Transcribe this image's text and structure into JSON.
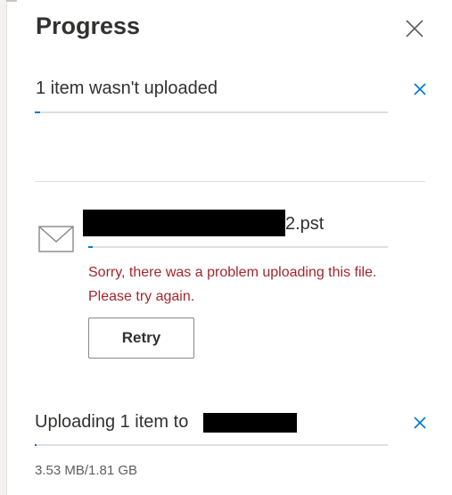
{
  "panel": {
    "title": "Progress"
  },
  "failed_item": {
    "summary": "1 item wasn't uploaded",
    "progress_fraction": 0.015
  },
  "file": {
    "name_suffix": "2.pst",
    "progress_fraction": 0.015,
    "error_line1": "Sorry, there was a problem uploading this file.",
    "error_line2": "Please try again.",
    "retry_label": "Retry"
  },
  "upload": {
    "status_prefix": "Uploading 1 item to",
    "progress_fraction": 0.005,
    "size_text": "3.53 MB/1.81 GB"
  },
  "colors": {
    "accent": "#0078d4",
    "error": "#a4262c",
    "track": "#e1dfdd"
  },
  "icons": [
    "close-icon",
    "dismiss-icon",
    "mail-icon"
  ]
}
